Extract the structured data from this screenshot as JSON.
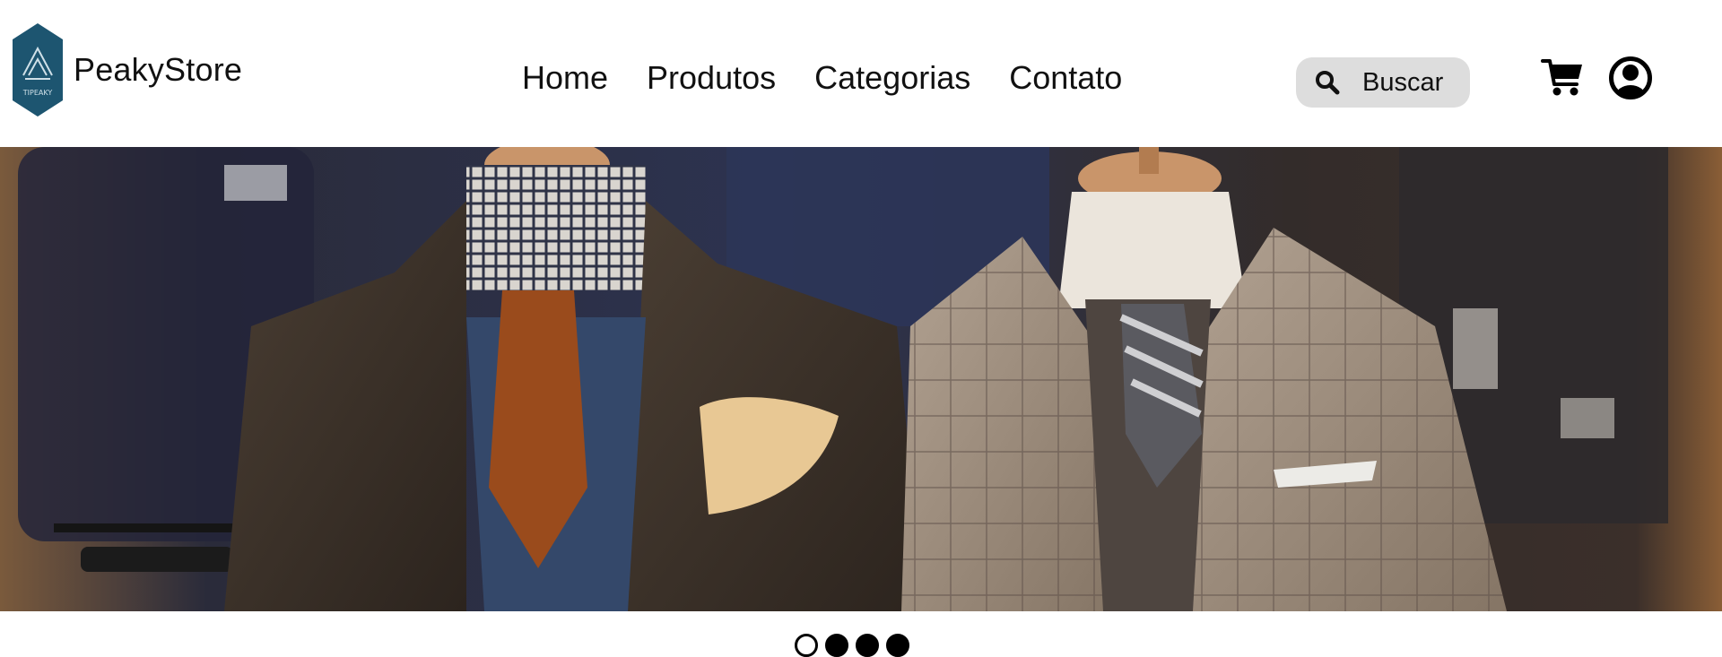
{
  "brand": {
    "name": "PeakyStore",
    "logo_text": "TIPEAKY",
    "logo_color": "#1d5570"
  },
  "nav": {
    "items": [
      {
        "label": "Home"
      },
      {
        "label": "Produtos"
      },
      {
        "label": "Categorias"
      },
      {
        "label": "Contato"
      }
    ]
  },
  "search": {
    "label": "Buscar",
    "icon": "search-icon",
    "background": "#dddddd"
  },
  "header_icons": {
    "cart": "cart-icon",
    "account": "user-circle-icon"
  },
  "hero": {
    "image": "two mannequins wearing tweed suit jackets with ties and pocket squares in a clothing store"
  },
  "carousel": {
    "slide_count": 4,
    "active_index": 0
  }
}
